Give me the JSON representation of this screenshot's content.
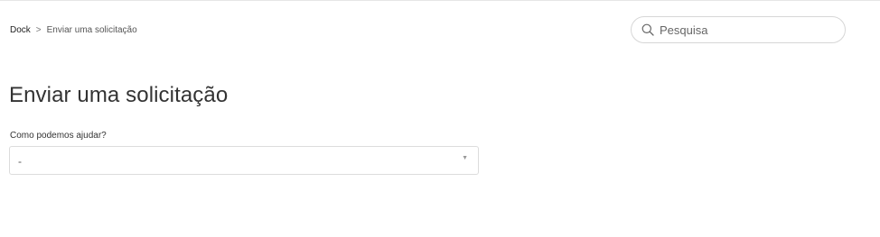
{
  "breadcrumb": {
    "home": "Dock",
    "separator": ">",
    "current": "Enviar uma solicitação"
  },
  "search": {
    "placeholder": "Pesquisa",
    "icon": "search-icon"
  },
  "page": {
    "title": "Enviar uma solicitação"
  },
  "form": {
    "help_label": "Como podemos ajudar?",
    "help_select_value": "-",
    "chevron_icon": "chevron-down-icon"
  }
}
